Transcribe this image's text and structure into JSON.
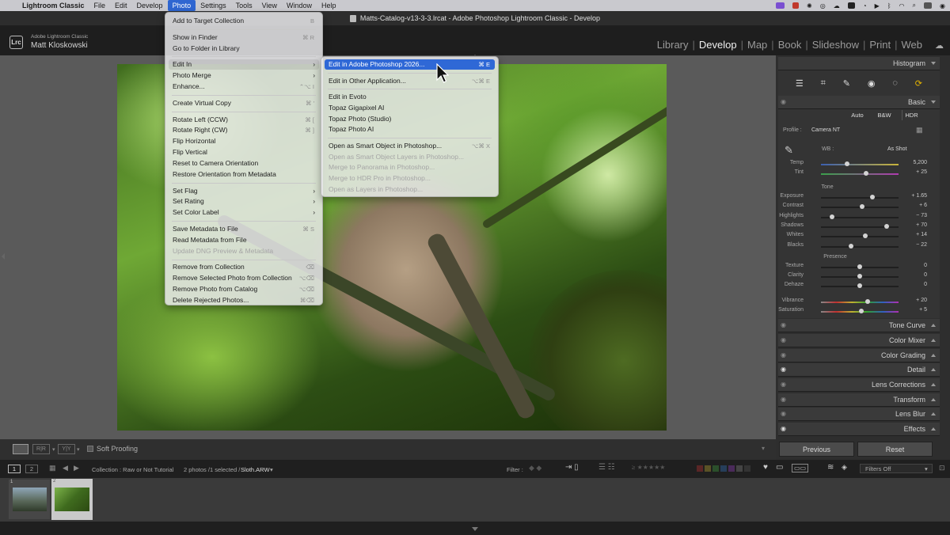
{
  "menubar": {
    "items": [
      "Lightroom Classic",
      "File",
      "Edit",
      "Develop",
      "Photo",
      "Settings",
      "Tools",
      "View",
      "Window",
      "Help"
    ],
    "active_item": "Photo"
  },
  "window_title": "Matts-Catalog-v13-3-3.lrcat - Adobe Photoshop Lightroom Classic - Develop",
  "identity": {
    "app_name": "Adobe Lightroom Classic",
    "user_name": "Matt Kloskowski",
    "logo_text": "Lrc"
  },
  "modules": [
    "Library",
    "Develop",
    "Map",
    "Book",
    "Slideshow",
    "Print",
    "Web"
  ],
  "active_module": "Develop",
  "photo_menu": {
    "items": [
      {
        "label": "Add to Target Collection",
        "shortcut": "B",
        "disabled": false,
        "submenu": false
      },
      {
        "sep": true
      },
      {
        "label": "Show in Finder",
        "shortcut": "⌘ R",
        "disabled": false,
        "submenu": false
      },
      {
        "label": "Go to Folder in Library",
        "shortcut": "",
        "disabled": false,
        "submenu": false
      },
      {
        "sep": true
      },
      {
        "label": "Edit In",
        "shortcut": "",
        "disabled": false,
        "submenu": true,
        "highlight": "parent"
      },
      {
        "label": "Photo Merge",
        "shortcut": "",
        "disabled": false,
        "submenu": true
      },
      {
        "label": "Enhance...",
        "shortcut": "⌃⌥ I",
        "disabled": false,
        "submenu": false
      },
      {
        "sep": true
      },
      {
        "label": "Create Virtual Copy",
        "shortcut": "⌘ '",
        "disabled": false,
        "submenu": false
      },
      {
        "sep": true
      },
      {
        "label": "Rotate Left (CCW)",
        "shortcut": "⌘ [",
        "disabled": false,
        "submenu": false
      },
      {
        "label": "Rotate Right (CW)",
        "shortcut": "⌘ ]",
        "disabled": false,
        "submenu": false
      },
      {
        "label": "Flip Horizontal",
        "shortcut": "",
        "disabled": false,
        "submenu": false
      },
      {
        "label": "Flip Vertical",
        "shortcut": "",
        "disabled": false,
        "submenu": false
      },
      {
        "label": "Reset to Camera Orientation",
        "shortcut": "",
        "disabled": false,
        "submenu": false
      },
      {
        "label": "Restore Orientation from Metadata",
        "shortcut": "",
        "disabled": false,
        "submenu": false
      },
      {
        "sep": true
      },
      {
        "label": "Set Flag",
        "shortcut": "",
        "disabled": false,
        "submenu": true
      },
      {
        "label": "Set Rating",
        "shortcut": "",
        "disabled": false,
        "submenu": true
      },
      {
        "label": "Set Color Label",
        "shortcut": "",
        "disabled": false,
        "submenu": true
      },
      {
        "sep": true
      },
      {
        "label": "Save Metadata to File",
        "shortcut": "⌘ S",
        "disabled": false,
        "submenu": false
      },
      {
        "label": "Read Metadata from File",
        "shortcut": "",
        "disabled": false,
        "submenu": false
      },
      {
        "label": "Update DNG Preview & Metadata",
        "shortcut": "",
        "disabled": true,
        "submenu": false
      },
      {
        "sep": true
      },
      {
        "label": "Remove from Collection",
        "shortcut": "⌫",
        "disabled": false,
        "submenu": false
      },
      {
        "label": "Remove Selected Photo from Collection",
        "shortcut": "⌥⌫",
        "disabled": false,
        "submenu": false
      },
      {
        "label": "Remove Photo from Catalog",
        "shortcut": "⌥⌫",
        "disabled": false,
        "submenu": false
      },
      {
        "label": "Delete Rejected Photos...",
        "shortcut": "⌘⌫",
        "disabled": false,
        "submenu": false
      }
    ]
  },
  "edit_in_menu": {
    "items": [
      {
        "label": "Edit in Adobe Photoshop 2026...",
        "shortcut": "⌘ E",
        "disabled": false,
        "highlight": true
      },
      {
        "sep": true
      },
      {
        "label": "Edit in Other Application...",
        "shortcut": "⌥⌘ E",
        "disabled": false
      },
      {
        "sep": true
      },
      {
        "label": "Edit in Evoto",
        "shortcut": "",
        "disabled": false
      },
      {
        "label": "Topaz Gigapixel AI",
        "shortcut": "",
        "disabled": false
      },
      {
        "label": "Topaz Photo (Studio)",
        "shortcut": "",
        "disabled": false
      },
      {
        "label": "Topaz Photo AI",
        "shortcut": "",
        "disabled": false
      },
      {
        "sep": true
      },
      {
        "label": "Open as Smart Object in Photoshop...",
        "shortcut": "⌥⌘ X",
        "disabled": false
      },
      {
        "label": "Open as Smart Object Layers in Photoshop...",
        "shortcut": "",
        "disabled": true
      },
      {
        "label": "Merge to Panorama in Photoshop...",
        "shortcut": "",
        "disabled": true
      },
      {
        "label": "Merge to HDR Pro in Photoshop...",
        "shortcut": "",
        "disabled": true
      },
      {
        "label": "Open as Layers in Photoshop...",
        "shortcut": "",
        "disabled": true
      }
    ]
  },
  "right_panel": {
    "histogram": "Histogram",
    "basic": "Basic",
    "treatment_buttons": [
      "Auto",
      "B&W",
      "HDR"
    ],
    "profile_label": "Profile :",
    "profile_value": "Camera NT",
    "wb_label": "WB :",
    "wb_value": "As Shot",
    "wb_sliders": [
      {
        "label": "Temp",
        "value": "5,200",
        "pos": 0.34
      },
      {
        "label": "Tint",
        "value": "+ 25",
        "pos": 0.58
      }
    ],
    "tone_title": "Tone",
    "tone_sliders": [
      {
        "label": "Exposure",
        "value": "+ 1.65",
        "pos": 0.66
      },
      {
        "label": "Contrast",
        "value": "+ 6",
        "pos": 0.53
      },
      {
        "label": "Highlights",
        "value": "− 73",
        "pos": 0.14
      },
      {
        "label": "Shadows",
        "value": "+ 70",
        "pos": 0.85
      },
      {
        "label": "Whites",
        "value": "+ 14",
        "pos": 0.57
      },
      {
        "label": "Blacks",
        "value": "− 22",
        "pos": 0.39
      }
    ],
    "presence_title": "Presence",
    "presence_sliders": [
      {
        "label": "Texture",
        "value": "0",
        "pos": 0.5
      },
      {
        "label": "Clarity",
        "value": "0",
        "pos": 0.5
      },
      {
        "label": "Dehaze",
        "value": "0",
        "pos": 0.5
      },
      {
        "label": "Vibrance",
        "value": "+ 20",
        "pos": 0.6
      },
      {
        "label": "Saturation",
        "value": "+ 5",
        "pos": 0.52
      }
    ],
    "collapsed_panels": [
      "Tone Curve",
      "Color Mixer",
      "Color Grading",
      "Detail",
      "Lens Corrections",
      "Transform",
      "Lens Blur",
      "Effects"
    ],
    "previous_label": "Previous",
    "reset_label": "Reset"
  },
  "toolbar": {
    "soft_proofing": "Soft Proofing"
  },
  "filmstrip": {
    "page_nums": [
      "1",
      "2"
    ],
    "collection_label": "Collection : Raw or Not Tutorial",
    "photo_count": "2 photos /1 selected /",
    "filename": "Sloth.ARW",
    "filter_label": "Filter :",
    "filters_off": "Filters Off",
    "thumb_nums": [
      "1",
      "2"
    ]
  },
  "colors": {
    "menu_highlight": "#2f68d6",
    "panel_bg": "#2e2e2e",
    "accent_active_module": "#f0f0f0"
  }
}
